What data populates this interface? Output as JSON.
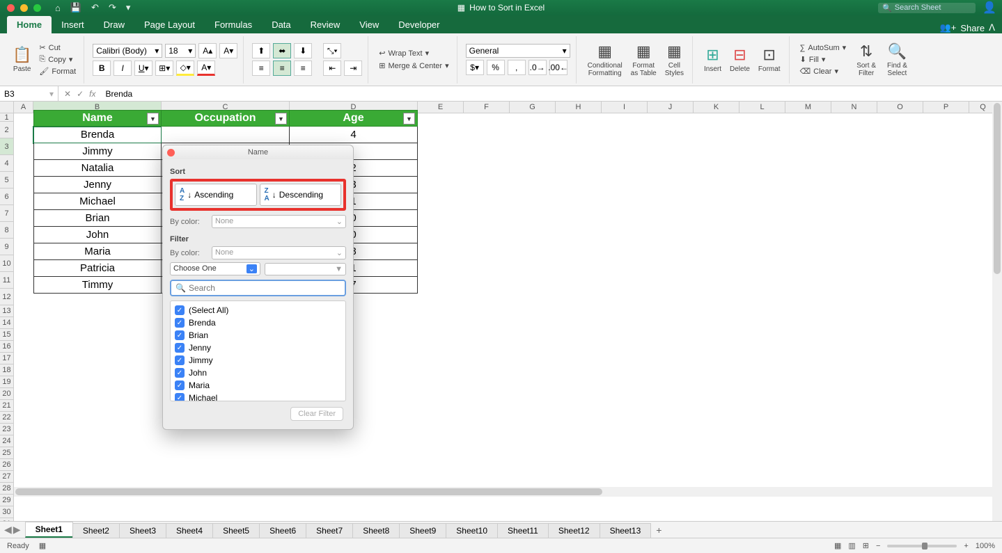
{
  "title": "How to Sort in Excel",
  "search_placeholder": "Search Sheet",
  "share": "Share",
  "tabs": [
    "Home",
    "Insert",
    "Draw",
    "Page Layout",
    "Formulas",
    "Data",
    "Review",
    "View",
    "Developer"
  ],
  "active_tab": "Home",
  "clipboard": {
    "paste": "Paste",
    "cut": "Cut",
    "copy": "Copy",
    "format": "Format"
  },
  "font": {
    "name": "Calibri (Body)",
    "size": "18"
  },
  "alignment": {
    "wrap": "Wrap Text",
    "merge": "Merge & Center"
  },
  "number": {
    "format": "General"
  },
  "styles": {
    "cf": "Conditional\nFormatting",
    "fat": "Format\nas Table",
    "cs": "Cell\nStyles"
  },
  "cells": {
    "insert": "Insert",
    "delete": "Delete",
    "format": "Format"
  },
  "editing": {
    "autosum": "AutoSum",
    "fill": "Fill",
    "clear": "Clear",
    "sortfilter": "Sort &\nFilter",
    "findselect": "Find &\nSelect"
  },
  "namebox": "B3",
  "formula": "Brenda",
  "columns": [
    "A",
    "B",
    "C",
    "D",
    "E",
    "F",
    "G",
    "H",
    "I",
    "J",
    "K",
    "L",
    "M",
    "N",
    "O",
    "P",
    "Q"
  ],
  "table": {
    "headers": [
      "Name",
      "Occupation",
      "Age"
    ],
    "rows": [
      {
        "name": "Brenda",
        "age": "4"
      },
      {
        "name": "Jimmy",
        "age": ""
      },
      {
        "name": "Natalia",
        "age": "2"
      },
      {
        "name": "Jenny",
        "age": "3"
      },
      {
        "name": "Michael",
        "age": "1"
      },
      {
        "name": "Brian",
        "age": "0"
      },
      {
        "name": "John",
        "age": "0"
      },
      {
        "name": "Maria",
        "age": "8"
      },
      {
        "name": "Patricia",
        "age": "1"
      },
      {
        "name": "Timmy",
        "age": "7"
      }
    ]
  },
  "popup": {
    "title": "Name",
    "sort_h": "Sort",
    "asc": "Ascending",
    "desc": "Descending",
    "bycolor": "By color:",
    "none": "None",
    "filter_h": "Filter",
    "choose": "Choose One",
    "search_ph": "Search",
    "items": [
      "(Select All)",
      "Brenda",
      "Brian",
      "Jenny",
      "Jimmy",
      "John",
      "Maria",
      "Michael"
    ],
    "clear": "Clear Filter"
  },
  "sheets": [
    "Sheet1",
    "Sheet2",
    "Sheet3",
    "Sheet4",
    "Sheet5",
    "Sheet6",
    "Sheet7",
    "Sheet8",
    "Sheet9",
    "Sheet10",
    "Sheet11",
    "Sheet12",
    "Sheet13"
  ],
  "active_sheet": "Sheet1",
  "status": "Ready",
  "zoom": "100%"
}
